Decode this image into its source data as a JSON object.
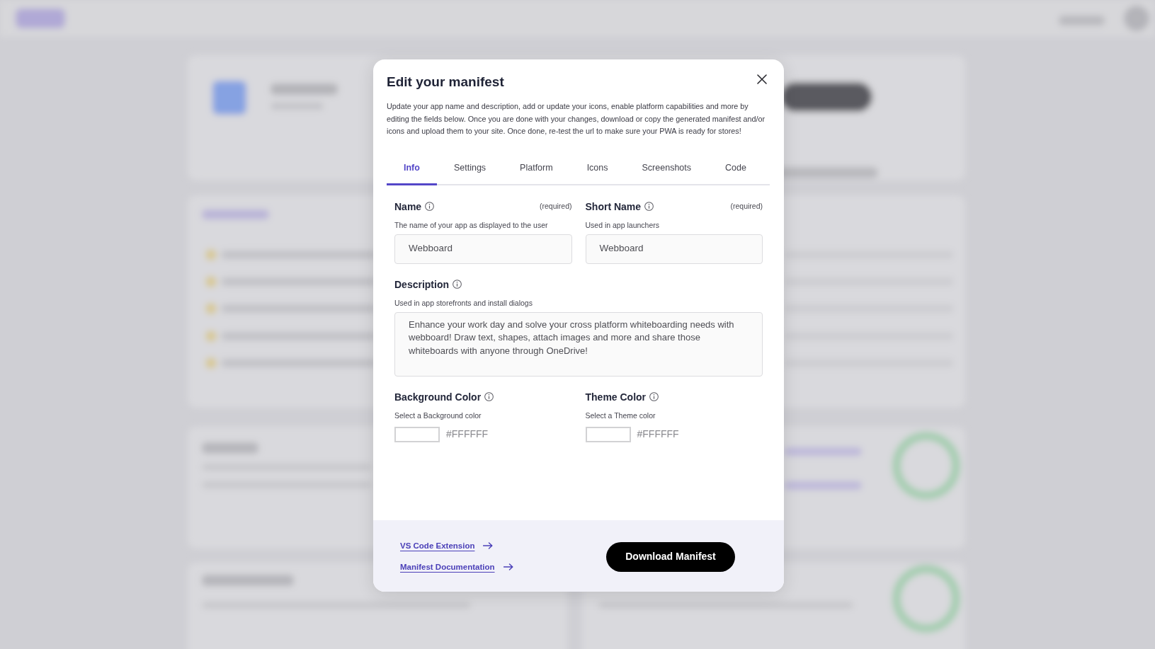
{
  "dialog": {
    "title": "Edit your manifest",
    "intro": "Update your app name and description, add or update your icons, enable platform capabilities and more by editing the fields below. Once you are done with your changes, download or copy the generated manifest and/or icons and upload them to your site. Once done, re-test the url to make sure your PWA is ready for stores!"
  },
  "tabs": [
    {
      "label": "Info",
      "selected": true
    },
    {
      "label": "Settings",
      "selected": false
    },
    {
      "label": "Platform",
      "selected": false
    },
    {
      "label": "Icons",
      "selected": false
    },
    {
      "label": "Screenshots",
      "selected": false
    },
    {
      "label": "Code",
      "selected": false
    }
  ],
  "fields": [
    {
      "kind": "text",
      "label": "Name",
      "required_note": "(required)",
      "hint": "The name of your app as displayed to the user",
      "value": "Webboard"
    },
    {
      "kind": "text",
      "label": "Short Name",
      "required_note": "(required)",
      "hint": "Used in app launchers",
      "value": "Webboard"
    },
    {
      "kind": "textarea",
      "label": "Description",
      "hint": "Used in app storefronts and install dialogs",
      "value": "Enhance your work day and solve your cross platform whiteboarding needs with webboard! Draw text, shapes, attach images and more and share those whiteboards with anyone through OneDrive!"
    },
    {
      "kind": "color",
      "label": "Background Color",
      "hint": "Select a Background color",
      "value": "#FFFFFF"
    },
    {
      "kind": "color",
      "label": "Theme Color",
      "hint": "Select a Theme color",
      "value": "#FFFFFF"
    }
  ],
  "footer": {
    "links": [
      "VS Code Extension",
      "Manifest Documentation"
    ],
    "button": "Download Manifest"
  }
}
